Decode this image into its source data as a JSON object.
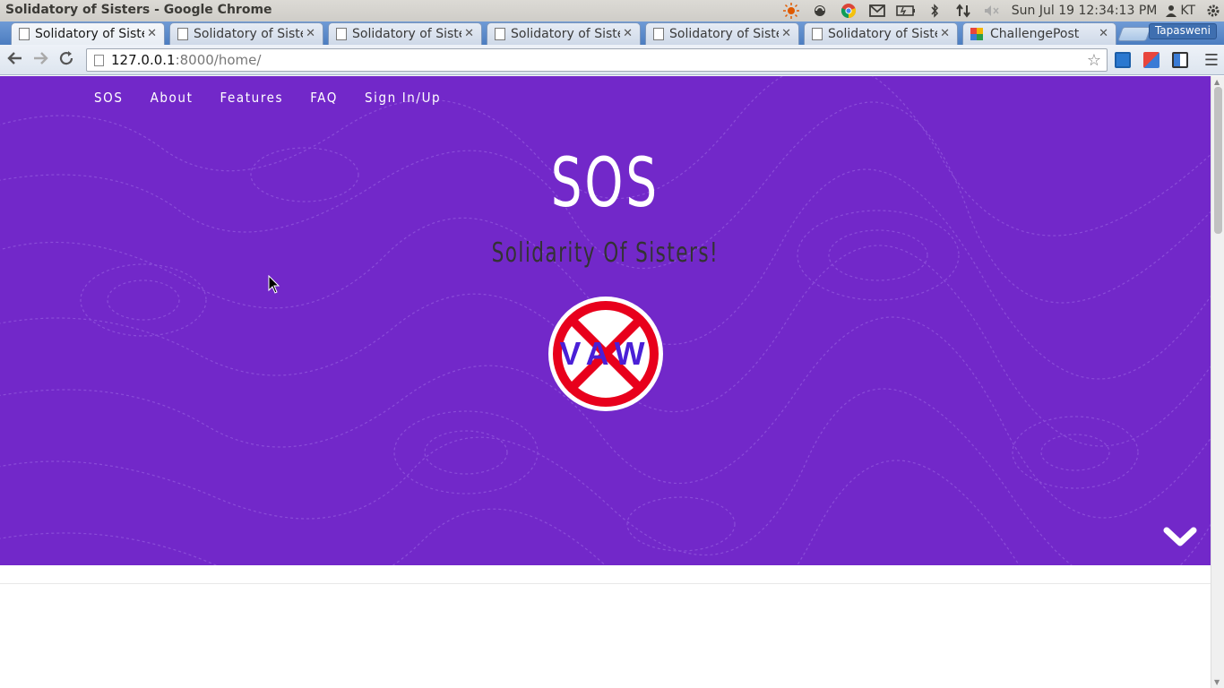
{
  "window": {
    "title": "Solidatory of Sisters - Google Chrome"
  },
  "tray": {
    "clock": "Sun Jul 19 12:34:13 PM",
    "user": "KT",
    "icons": [
      "weather-icon",
      "sync-icon",
      "chrome-icon",
      "mail-icon",
      "battery-icon",
      "bluetooth-icon",
      "network-icon",
      "volume-muted-icon",
      "settings-gear-icon"
    ]
  },
  "tabs": [
    {
      "label": "Solidatory of Sisters",
      "active": true
    },
    {
      "label": "Solidatory of Sisters",
      "active": false
    },
    {
      "label": "Solidatory of Sisters",
      "active": false
    },
    {
      "label": "Solidatory of Sisters",
      "active": false
    },
    {
      "label": "Solidatory of Sisters",
      "active": false
    },
    {
      "label": "Solidatory of Sisters",
      "active": false
    },
    {
      "label": "ChallengePost",
      "active": false
    }
  ],
  "profile": "Tapasweni",
  "address": {
    "host": "127.0.0.1",
    "path": ":8000/home/"
  },
  "page": {
    "nav": [
      "SOS",
      "About",
      "Features",
      "FAQ",
      "Sign In/Up"
    ],
    "hero_title": "SOS",
    "hero_subtitle": "Solidarity Of Sisters!",
    "logo_text": "VAW"
  },
  "colors": {
    "hero_bg": "#7228c9",
    "logo_red": "#e8001c",
    "logo_text": "#4a1fd6"
  }
}
